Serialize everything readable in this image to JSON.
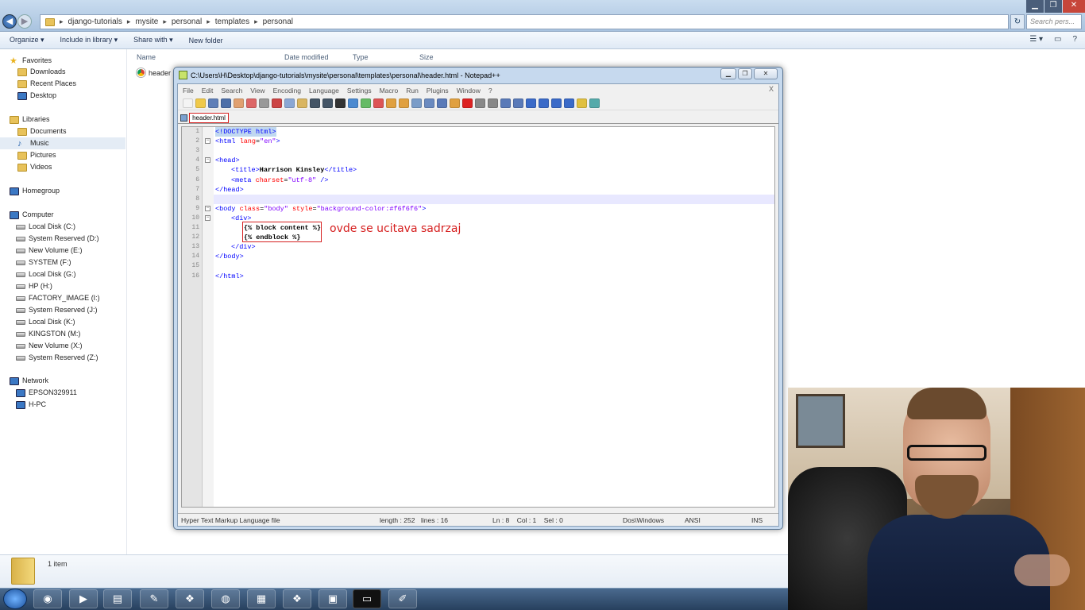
{
  "explorer": {
    "breadcrumb": [
      "django-tutorials",
      "mysite",
      "personal",
      "templates",
      "personal"
    ],
    "search_placeholder": "Search pers...",
    "commands": [
      "Organize ▾",
      "Include in library ▾",
      "Share with ▾",
      "New folder"
    ],
    "columns": [
      "Name",
      "Date modified",
      "Type",
      "Size"
    ],
    "file_name": "header",
    "item_count": "1 item",
    "nav": {
      "favorites": "Favorites",
      "downloads": "Downloads",
      "recent": "Recent Places",
      "desktop": "Desktop",
      "libraries": "Libraries",
      "documents": "Documents",
      "music": "Music",
      "pictures": "Pictures",
      "videos": "Videos",
      "homegroup": "Homegroup",
      "computer": "Computer",
      "drives": [
        "Local Disk (C:)",
        "System Reserved (D:)",
        "New Volume (E:)",
        "SYSTEM (F:)",
        "Local Disk (G:)",
        "HP (H:)",
        "FACTORY_IMAGE (I:)",
        "System Reserved (J:)",
        "Local Disk (K:)",
        "KINGSTON (M:)",
        "New Volume (X:)",
        "System Reserved (Z:)"
      ],
      "network": "Network",
      "network_items": [
        "EPSON329911",
        "H-PC"
      ]
    }
  },
  "notepad": {
    "title": "C:\\Users\\H\\Desktop\\django-tutorials\\mysite\\personal\\templates\\personal\\header.html - Notepad++",
    "menu": [
      "File",
      "Edit",
      "Search",
      "View",
      "Encoding",
      "Language",
      "Settings",
      "Macro",
      "Run",
      "Plugins",
      "Window",
      "?"
    ],
    "menu_close": "X",
    "tab_label": "header.html",
    "line_numbers": [
      "1",
      "2",
      "3",
      "4",
      "5",
      "6",
      "7",
      "8",
      "9",
      "10",
      "11",
      "12",
      "13",
      "14",
      "15",
      "16"
    ],
    "annotation": "ovde se ucitava sadrzaj",
    "status": {
      "file_type": "Hyper Text Markup Language file",
      "length": "length : 252",
      "lines": "lines : 16",
      "position": "Ln : 8    Col : 1    Sel : 0",
      "eol": "Dos\\Windows",
      "encoding": "ANSI",
      "mode": "INS"
    }
  },
  "code": {
    "l1": "<!DOCTYPE html>",
    "l2_tag": "<html ",
    "l2_attr": "lang",
    "l2_eq": "=",
    "l2_val": "\"en\"",
    "l2_end": ">",
    "l4": "<head>",
    "l5_open": "<title>",
    "l5_text": "Harrison Kinsley",
    "l5_close": "</title>",
    "l6_tag": "<meta ",
    "l6_attr": "charset",
    "l6_eq": "=",
    "l6_val": "\"utf-8\"",
    "l6_end": " />",
    "l7": "</head>",
    "l9_tag": "<body ",
    "l9_attr1": "class",
    "l9_eq1": "=",
    "l9_val1": "\"body\"",
    "l9_attr2": " style",
    "l9_eq2": "=",
    "l9_val2": "\"background-color:#f6f6f6\"",
    "l9_end": ">",
    "l10": "<div>",
    "l11": "{% block content %}",
    "l12": "{% endblock %}",
    "l13": "</div>",
    "l14": "</body>",
    "l16": "</html>"
  },
  "window_controls": {
    "minimize": "▁",
    "restore": "❐",
    "close": "✕"
  }
}
